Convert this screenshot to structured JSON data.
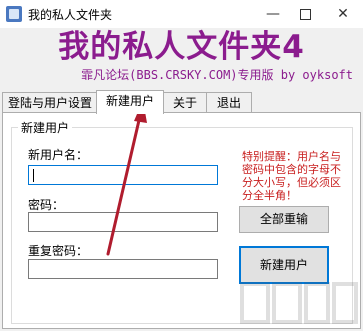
{
  "window": {
    "title": "我的私人文件夹",
    "min_glyph": "—",
    "close_glyph": "✕"
  },
  "banner": {
    "title": "我的私人文件夹4",
    "subtitle": "霏凡论坛(BBS.CRSKY.COM)专用版 by oyksoft"
  },
  "tabs": [
    {
      "label": "登陆与用户设置"
    },
    {
      "label": "新建用户"
    },
    {
      "label": "关于"
    },
    {
      "label": "退出"
    }
  ],
  "group": {
    "title": "新建用户"
  },
  "form": {
    "username_label": "新用户名：",
    "username_value": "",
    "password_label": "密码：",
    "password_value": "",
    "confirm_label": "重复密码：",
    "confirm_value": ""
  },
  "notice": "特别提醒：用户名与密码中包含的字母不分大小写，但必须区分全半角！",
  "buttons": {
    "reset_label": "全部重输",
    "create_label": "新建用户"
  },
  "colors": {
    "banner": "#8b1c8e",
    "notice": "#c81e1e",
    "arrow": "#b01c2e"
  }
}
